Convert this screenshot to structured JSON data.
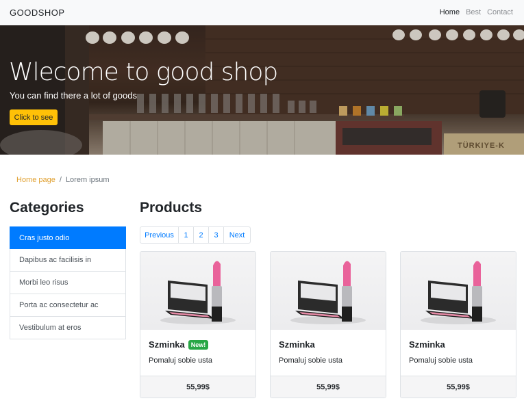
{
  "navbar": {
    "brand": "GOODSHOP",
    "links": [
      {
        "label": "Home",
        "active": true
      },
      {
        "label": "Best",
        "active": false
      },
      {
        "label": "Contact",
        "active": false
      }
    ]
  },
  "hero": {
    "title": "Wlecome to good shop",
    "subtitle": "You can find there a lot of goods",
    "button_label": "Click to see",
    "image_label": "TÜRKIYE-K"
  },
  "breadcrumb": {
    "home": "Home page",
    "separator": "/",
    "current": "Lorem ipsum"
  },
  "categories": {
    "title": "Categories",
    "items": [
      {
        "label": "Cras justo odio",
        "active": true
      },
      {
        "label": "Dapibus ac facilisis in",
        "active": false
      },
      {
        "label": "Morbi leo risus",
        "active": false
      },
      {
        "label": "Porta ac consectetur ac",
        "active": false
      },
      {
        "label": "Vestibulum at eros",
        "active": false
      }
    ]
  },
  "products": {
    "title": "Products",
    "pagination": [
      "Previous",
      "1",
      "2",
      "3",
      "Next"
    ],
    "cards": [
      {
        "name": "Szminka",
        "badge": "New!",
        "desc": "Pomaluj sobie usta",
        "price": "55,99$",
        "image_icon": "lipstick-compact-icon"
      },
      {
        "name": "Szminka",
        "badge": "",
        "desc": "Pomaluj sobie usta",
        "price": "55,99$",
        "image_icon": "lipstick-compact-icon"
      },
      {
        "name": "Szminka",
        "badge": "",
        "desc": "Pomaluj sobie usta",
        "price": "55,99$",
        "image_icon": "lipstick-compact-icon"
      }
    ]
  },
  "colors": {
    "accent_yellow": "#ffc107",
    "primary_blue": "#007bff",
    "badge_green": "#28a745",
    "breadcrumb_link": "#e0a030"
  }
}
